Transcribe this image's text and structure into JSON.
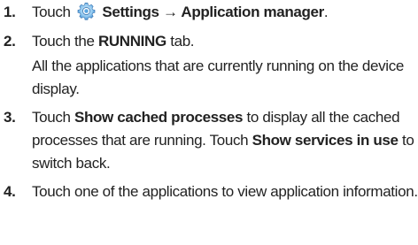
{
  "steps": [
    {
      "number": "1.",
      "pre": "Touch",
      "icon": "settings-gear-icon",
      "bold": "Settings → Application manager",
      "post": "."
    },
    {
      "number": "2.",
      "pre": "Touch the ",
      "bold": "RUNNING",
      "post": " tab.",
      "sub": "All the applications that are currently running on the device display."
    },
    {
      "number": "3.",
      "pre": "Touch ",
      "bold": "Show cached processes",
      "mid": " to display all the cached processes that are running. Touch ",
      "bold2": "Show services in use",
      "post": " to switch back."
    },
    {
      "number": "4.",
      "text": "Touch one of the applications to view application information."
    }
  ],
  "colors": {
    "text": "#222222",
    "icon_blue": "#2e7fc9",
    "icon_light": "#8fc7ef"
  }
}
